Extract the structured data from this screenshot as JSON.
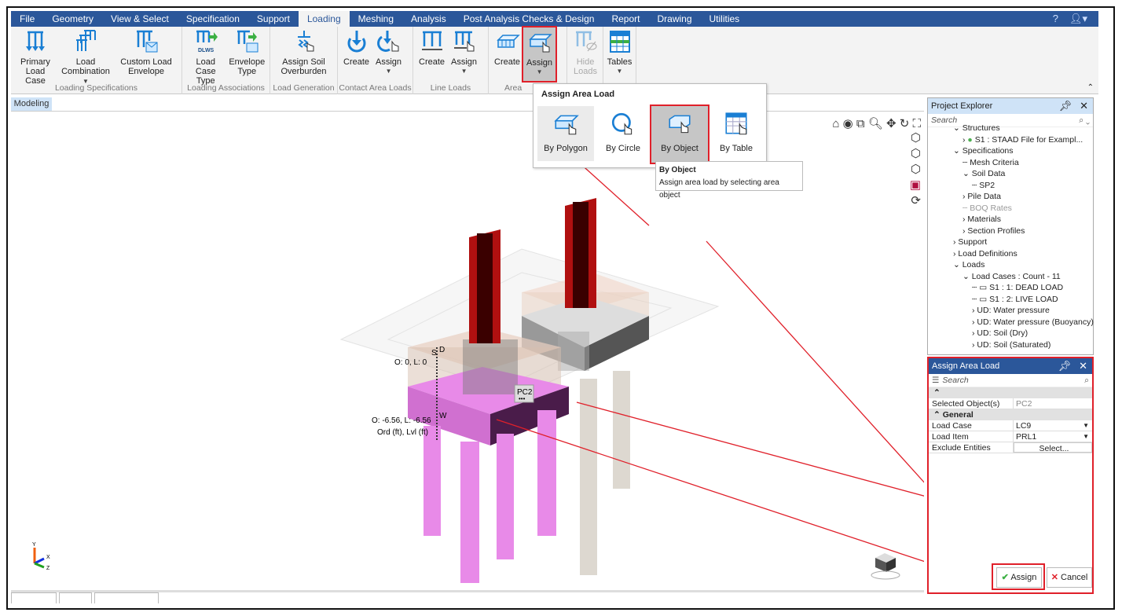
{
  "tabs": [
    "File",
    "Geometry",
    "View & Select",
    "Specification",
    "Support",
    "Loading",
    "Meshing",
    "Analysis",
    "Post Analysis Checks & Design",
    "Report",
    "Drawing",
    "Utilities"
  ],
  "active_tab": "Loading",
  "ribbon": {
    "loading_specifications": {
      "label": "Loading Specifications",
      "primary": "Primary Load Case",
      "combination": "Load Combination",
      "custom": "Custom Load Envelope"
    },
    "loading_associations": {
      "label": "Loading Associations",
      "case_type": "Load Case Type",
      "case_type_badge": "DLWS",
      "envelope": "Envelope Type"
    },
    "load_generation": {
      "label": "Load Generation",
      "soil": "Assign Soil Overburden"
    },
    "contact_area": {
      "label": "Contact Area Loads",
      "create": "Create",
      "assign": "Assign"
    },
    "line_loads": {
      "label": "Line Loads",
      "create": "Create",
      "assign": "Assign"
    },
    "area": {
      "label": "Area",
      "create": "Create",
      "assign": "Assign"
    },
    "hide_loads": "Hide Loads",
    "tables": "Tables"
  },
  "subtab": "Modeling",
  "popup": {
    "title": "Assign Area Load",
    "items": [
      "By Polygon",
      "By Circle",
      "By Object",
      "By Table"
    ],
    "tooltip_title": "By Object",
    "tooltip_text": "Assign area load by selecting area object"
  },
  "viewport": {
    "label_top": "O: 0, L: 0",
    "label_bottom": "O: -6.56, L: -6.56",
    "units": "Ord (ft), Lvl (ft)",
    "selected_label": "PC2",
    "pc_more": "•••",
    "axis": {
      "y": "Y",
      "x": "X",
      "z": "Z"
    },
    "marker_s": "S",
    "marker_d": "D",
    "marker_w": "W"
  },
  "project_explorer": {
    "title": "Project Explorer",
    "search": "Search",
    "tree": [
      {
        "text": "Structures",
        "level": 1,
        "exp": "v"
      },
      {
        "text": "S1 : STAAD File for Exampl...",
        "level": 2,
        "exp": ">",
        "ok": true
      },
      {
        "text": "Specifications",
        "level": 1,
        "exp": "v"
      },
      {
        "text": "Mesh Criteria",
        "level": 2,
        "exp": ""
      },
      {
        "text": "Soil Data",
        "level": 2,
        "exp": "v"
      },
      {
        "text": "SP2",
        "level": 3,
        "exp": ""
      },
      {
        "text": "Pile Data",
        "level": 2,
        "exp": ">"
      },
      {
        "text": "BOQ Rates",
        "level": 2,
        "exp": "",
        "dim": true
      },
      {
        "text": "Materials",
        "level": 2,
        "exp": ">"
      },
      {
        "text": "Section Profiles",
        "level": 2,
        "exp": ">"
      },
      {
        "text": "Support",
        "level": 1,
        "exp": ">"
      },
      {
        "text": "Load Definitions",
        "level": 1,
        "exp": ">"
      },
      {
        "text": "Loads",
        "level": 1,
        "exp": "v"
      },
      {
        "text": "Load Cases : Count - 11",
        "level": 2,
        "exp": "v"
      },
      {
        "text": "S1 : 1: DEAD LOAD",
        "level": 3,
        "exp": "",
        "box": true
      },
      {
        "text": "S1 : 2: LIVE LOAD",
        "level": 3,
        "exp": "",
        "box": true
      },
      {
        "text": "UD: Water pressure",
        "level": 3,
        "exp": ">"
      },
      {
        "text": "UD: Water pressure (Buoyancy)",
        "level": 3,
        "exp": ">"
      },
      {
        "text": "UD: Soil (Dry)",
        "level": 3,
        "exp": ">"
      },
      {
        "text": "UD: Soil (Saturated)",
        "level": 3,
        "exp": ">"
      }
    ]
  },
  "assign_panel": {
    "title": "Assign Area Load",
    "search": "Search",
    "selected_label": "Selected Object(s)",
    "selected_value": "PC2",
    "general": "General",
    "load_case_label": "Load Case",
    "load_case": "LC9",
    "load_item_label": "Load Item",
    "load_item": "PRL1",
    "exclude_label": "Exclude Entities",
    "exclude_button": "Select...",
    "assign": "Assign",
    "cancel": "Cancel"
  },
  "colors": {
    "accent": "#2b579a",
    "highlight": "#e0202a",
    "footing": "#e88ae8",
    "column": "#b01010"
  }
}
